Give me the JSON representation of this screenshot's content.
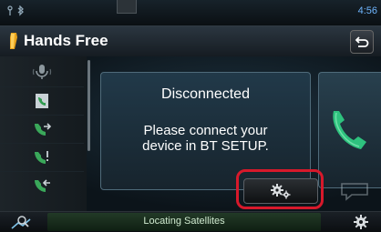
{
  "status_bar": {
    "time": "4:56",
    "icons": [
      "antenna-icon",
      "bluetooth-icon"
    ]
  },
  "header": {
    "title": "Hands Free",
    "back_icon": "back-arrow-icon"
  },
  "sidebar": {
    "items": [
      {
        "icon": "voice-recognition-icon"
      },
      {
        "icon": "phonebook-icon"
      },
      {
        "icon": "outgoing-calls-icon"
      },
      {
        "icon": "missed-calls-icon"
      },
      {
        "icon": "incoming-calls-icon"
      }
    ]
  },
  "main": {
    "status": "Disconnected",
    "instruction_line1": "Please connect your",
    "instruction_line2": "device in BT SETUP.",
    "dial_icon": "phone-handset-icon",
    "bt_setup_icon": "settings-gears-icon"
  },
  "bottom_bar": {
    "status_text": "Locating Satellites",
    "nav_icon": "navigation-icon",
    "settings_icon": "gear-icon"
  },
  "colors": {
    "accent_red": "#d7192b",
    "phone_green": "#2ec27e",
    "clock_blue": "#6fb6ff"
  }
}
